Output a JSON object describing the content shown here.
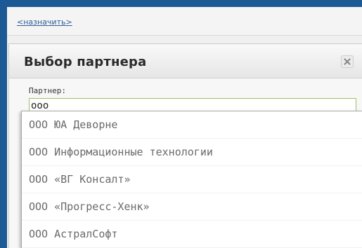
{
  "top": {
    "assign_link": "<назначить>"
  },
  "dialog": {
    "title": "Выбор партнера",
    "close_label": "×",
    "field_label": "Партнер:",
    "input_value": "ооо",
    "suggestions": [
      "ООО ЮА Деворне",
      "ООО Информационные технологии",
      "ООО «ВГ Консалт»",
      "ООО «Прогресс-Хенк»",
      "ООО АстралСофт"
    ]
  },
  "colors": {
    "frame": "#1c5a96",
    "input_border": "#9fc06a",
    "link": "#2f5d99"
  }
}
